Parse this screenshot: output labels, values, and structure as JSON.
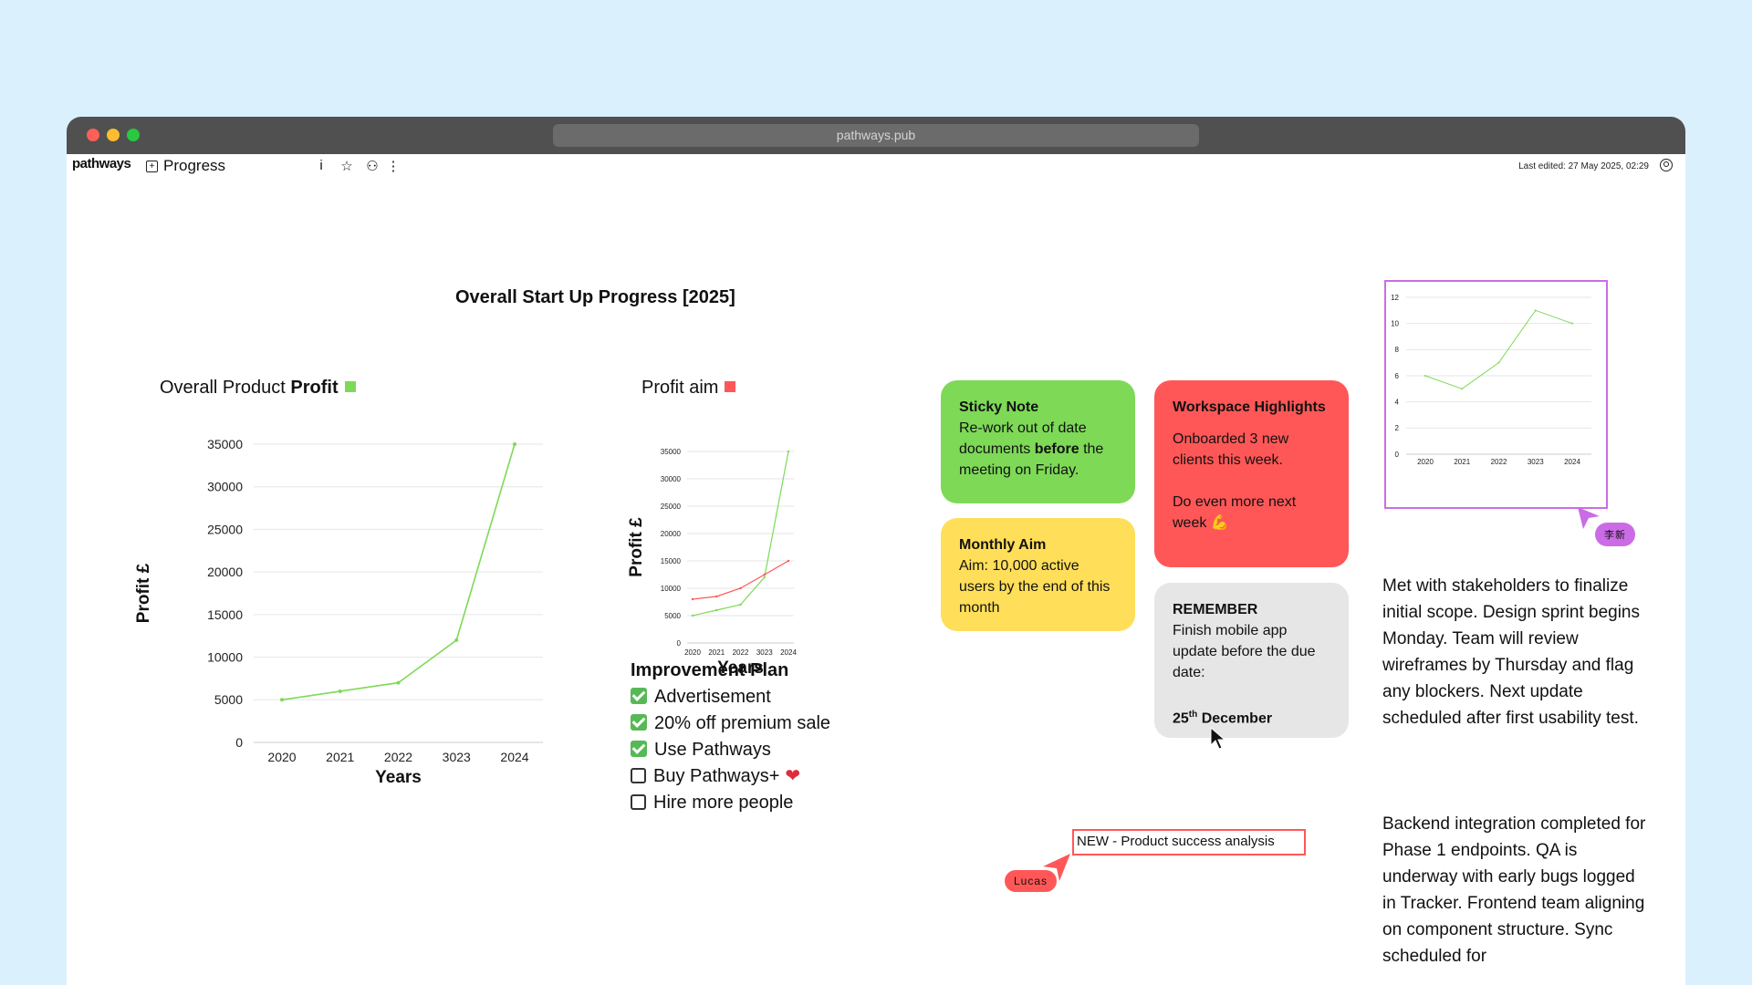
{
  "browser": {
    "url": "pathways.pub"
  },
  "toolbar": {
    "logo": "pathways",
    "doc_title": "Progress",
    "icons": [
      "info-icon",
      "star-icon",
      "share-people-icon",
      "more-vertical-icon"
    ],
    "last_edited": "Last edited: 27 May 2025, 02:29"
  },
  "heading": "Overall Start Up Progress [2025]",
  "chart1": {
    "title_prefix": "Overall Product ",
    "title_bold": "Profit",
    "legend_color": "#7ed957",
    "ylabel": "Profit £",
    "xlabel": "Years",
    "yticks": [
      "0",
      "5000",
      "10000",
      "15000",
      "20000",
      "25000",
      "30000",
      "35000"
    ],
    "xticks": [
      "2020",
      "2021",
      "2022",
      "3023",
      "2024"
    ]
  },
  "chart2": {
    "title": "Profit aim",
    "legend_color": "#ff5757",
    "ylabel": "Profit £",
    "xlabel": "Years",
    "yticks": [
      "0",
      "5000",
      "10000",
      "15000",
      "20000",
      "25000",
      "30000",
      "35000"
    ],
    "xticks": [
      "2020",
      "2021",
      "2022",
      "3023",
      "2024"
    ]
  },
  "chart3": {
    "yticks": [
      "0",
      "2",
      "4",
      "6",
      "8",
      "10",
      "12"
    ],
    "xticks": [
      "2020",
      "2021",
      "2022",
      "3023",
      "2024"
    ]
  },
  "chart_data": [
    {
      "type": "line",
      "title": "Overall Product Profit",
      "xlabel": "Years",
      "ylabel": "Profit £",
      "categories": [
        "2020",
        "2021",
        "2022",
        "3023",
        "2024"
      ],
      "series": [
        {
          "values": [
            5000,
            6000,
            7000,
            12000,
            35000
          ],
          "color": "#7ed957"
        }
      ],
      "ylim": [
        0,
        35000
      ],
      "grid": true
    },
    {
      "type": "line",
      "title": "Profit aim",
      "xlabel": "Years",
      "ylabel": "Profit £",
      "categories": [
        "2020",
        "2021",
        "2022",
        "3023",
        "2024"
      ],
      "series": [
        {
          "values": [
            5000,
            6000,
            7000,
            12000,
            35000
          ],
          "color": "#7ed957"
        },
        {
          "values": [
            8000,
            8500,
            10000,
            12500,
            15000
          ],
          "color": "#ff5757"
        }
      ],
      "ylim": [
        0,
        35000
      ],
      "grid": true
    },
    {
      "type": "line",
      "categories": [
        "2020",
        "2021",
        "2022",
        "3023",
        "2024"
      ],
      "series": [
        {
          "values": [
            6,
            5,
            7,
            11,
            10
          ],
          "color": "#7ed957"
        }
      ],
      "ylim": [
        0,
        12
      ],
      "grid": true
    }
  ],
  "plan": {
    "title": "Improvement Plan",
    "items": [
      {
        "label": "Advertisement",
        "checked": true
      },
      {
        "label": "20% off premium sale",
        "checked": true
      },
      {
        "label": "Use Pathways",
        "checked": true
      },
      {
        "label": "Buy Pathways+",
        "checked": false
      },
      {
        "label": "Hire more people",
        "checked": false
      }
    ],
    "heart": "❤"
  },
  "notes": {
    "sticky": {
      "title": "Sticky Note",
      "text_a": "Re-work out of date documents ",
      "text_bold": "before",
      "text_b": " the meeting on Friday.",
      "color": "#7ed957"
    },
    "monthly": {
      "title": "Monthly Aim",
      "text": "Aim: 10,000 active users by the end of this month",
      "color": "#ffde59"
    },
    "workspace": {
      "title": "Workspace Highlights",
      "text1": "Onboarded 3 new clients this week.",
      "text2": "Do even more next week",
      "emoji": "💪",
      "color": "#ff5757"
    },
    "remember": {
      "title": "REMEMBER",
      "text": "Finish mobile app update before the due date:",
      "date_num": "25",
      "date_sup": "th",
      "date_month": " December",
      "color": "#e6e6e6"
    }
  },
  "cursors": {
    "lee": "李新",
    "lucas": "Lucas"
  },
  "new_box": "NEW - Product success analysis",
  "paragraphs": {
    "p1": "Met with stakeholders to finalize initial scope. Design sprint begins Monday. Team will review wireframes by Thursday and flag any blockers. Next update scheduled after first usability test.",
    "p2": "Backend integration completed for Phase 1 endpoints. QA is underway with early bugs logged in Tracker. Frontend team aligning on component structure. Sync scheduled for"
  }
}
